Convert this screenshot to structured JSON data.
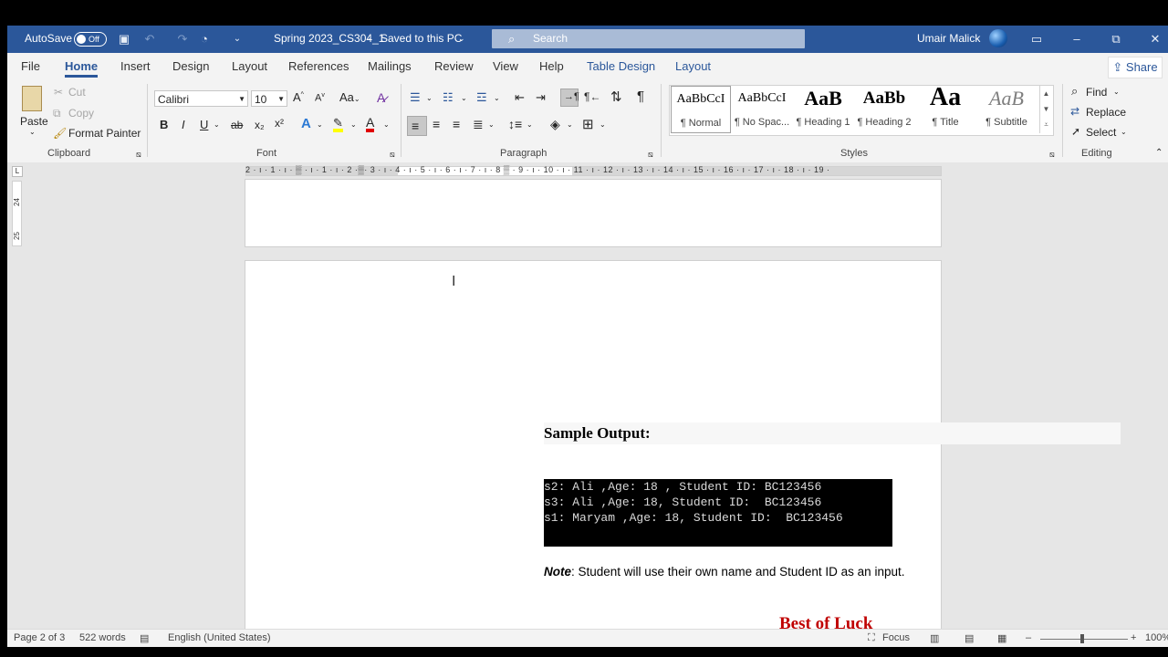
{
  "titlebar": {
    "autosave_label": "AutoSave",
    "autosave_state": "Off",
    "document_title": "Spring 2023_CS304_1",
    "save_status": "Saved to this PC",
    "search_placeholder": "Search",
    "user_name": "Umair Malick"
  },
  "menu": {
    "tabs": [
      "File",
      "Home",
      "Insert",
      "Design",
      "Layout",
      "References",
      "Mailings",
      "Review",
      "View",
      "Help"
    ],
    "context_tabs": [
      "Table Design",
      "Layout"
    ],
    "active_tab": "Home",
    "share_label": "Share"
  },
  "ribbon": {
    "clipboard": {
      "paste": "Paste",
      "cut": "Cut",
      "copy": "Copy",
      "format_painter": "Format Painter",
      "group_label": "Clipboard"
    },
    "font": {
      "font_name": "Calibri",
      "font_size": "10",
      "change_case": "Aa",
      "bold": "B",
      "italic": "I",
      "underline": "U",
      "strike": "ab",
      "subscript": "x₂",
      "superscript": "x²",
      "group_label": "Font"
    },
    "paragraph": {
      "group_label": "Paragraph"
    },
    "styles": {
      "items": [
        {
          "sample": "AaBbCcI",
          "name": "¶ Normal"
        },
        {
          "sample": "AaBbCcI",
          "name": "¶ No Spac..."
        },
        {
          "sample": "AaB",
          "name": "¶ Heading 1"
        },
        {
          "sample": "AaBb",
          "name": "¶ Heading 2"
        },
        {
          "sample": "Aa",
          "name": "¶ Title"
        },
        {
          "sample": "AaB",
          "name": "¶ Subtitle"
        }
      ],
      "group_label": "Styles"
    },
    "editing": {
      "find": "Find",
      "replace": "Replace",
      "select": "Select",
      "group_label": "Editing"
    }
  },
  "ruler": {
    "labels": "2 · ı · 1 · ı · ▒ · ı · 1 · ı · 2 ·▒· 3 · ı · 4 · ı · 5 · ı · 6 · ı · 7 · ı · 8 ▒ · 9 · ı · 10 · ı · 11 · ı · 12 · ı · 13 · ı · 14 · ı · 15 · ı · 16 · ı · 17 · ı · 18 · ı · 19 ·",
    "vertical_labels": [
      "24",
      "25"
    ]
  },
  "document": {
    "heading": "Sample Output:",
    "console_lines": [
      "s2: Ali ,Age: 18 , Student ID: BC123456",
      "s3: Ali ,Age: 18, Student ID:  BC123456",
      "s1: Maryam ,Age: 18, Student ID:  BC123456"
    ],
    "note_label": "Note",
    "note_text": ": Student will use their own name and Student ID as an input.",
    "closing": "Best of Luck"
  },
  "statusbar": {
    "page": "Page 2 of 3",
    "words": "522 words",
    "language": "English (United States)",
    "focus": "Focus",
    "zoom": "100%"
  },
  "colors": {
    "accent": "#2b579a",
    "closing_text": "#c00000"
  }
}
